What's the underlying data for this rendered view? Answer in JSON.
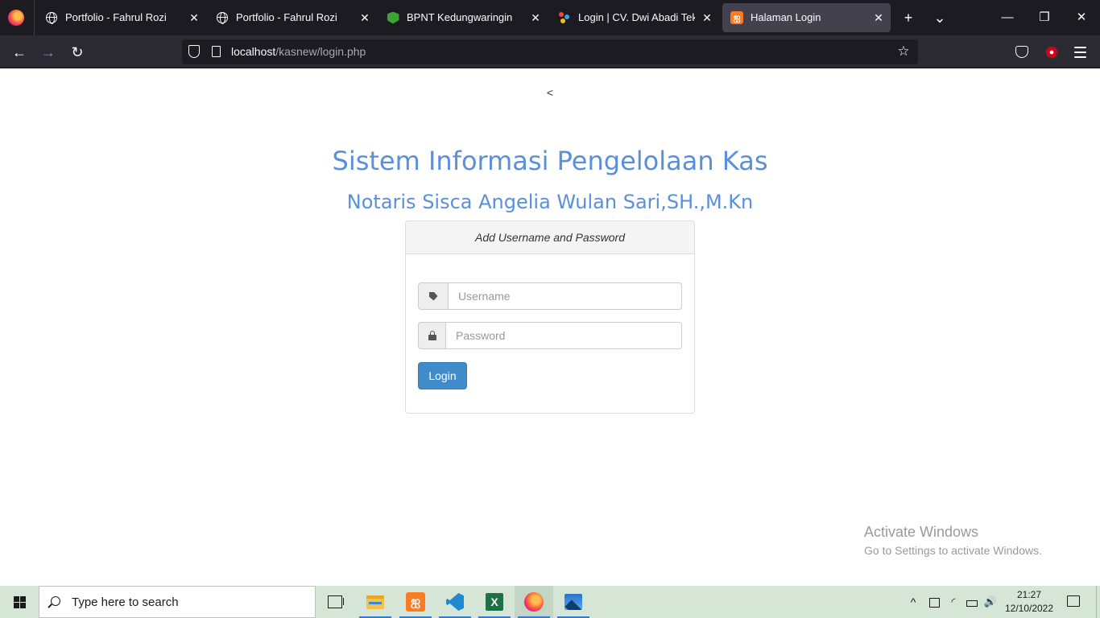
{
  "browser": {
    "tabs": [
      {
        "title": "Portfolio - Fahrul Rozi",
        "icon": "globe-icon",
        "active": false
      },
      {
        "title": "Portfolio - Fahrul Rozi",
        "icon": "globe-icon",
        "active": false
      },
      {
        "title": "BPNT Kedungwaringin",
        "icon": "bpnt-favicon",
        "active": false
      },
      {
        "title": "Login | CV. Dwi Abadi Teknik",
        "icon": "dots-favicon",
        "active": false
      },
      {
        "title": "Halaman Login",
        "icon": "xampp-favicon",
        "active": true
      }
    ],
    "tab_close_glyph": "✕",
    "new_tab_glyph": "+",
    "list_tabs_glyph": "⌄",
    "window_controls": {
      "minimize": "—",
      "restore": "❐",
      "close": "✕"
    },
    "nav": {
      "back": "←",
      "forward": "→",
      "reload": "↻"
    },
    "url_host": "localhost",
    "url_path": "/kasnew/login.php",
    "bookmark_glyph": "☆"
  },
  "page": {
    "stray_text": "<",
    "title": "Sistem Informasi Pengelolaan Kas",
    "subtitle": "Notaris Sisca Angelia Wulan Sari,SH.,M.Kn",
    "panel_heading": "Add Username and Password",
    "username_placeholder": "Username",
    "password_placeholder": "Password",
    "login_button": "Login",
    "accent_color": "#5a8fdc",
    "button_color": "#428bca"
  },
  "watermark": {
    "line1": "Activate Windows",
    "line2": "Go to Settings to activate Windows."
  },
  "taskbar": {
    "search_placeholder": "Type here to search",
    "apps": [
      "task-view-icon",
      "file-explorer-icon",
      "xampp-icon",
      "vscode-icon",
      "excel-icon",
      "firefox-icon",
      "photos-icon"
    ],
    "time": "21:27",
    "date": "12/10/2022",
    "tray_chevron": "^",
    "tray_volume": "🔊"
  }
}
